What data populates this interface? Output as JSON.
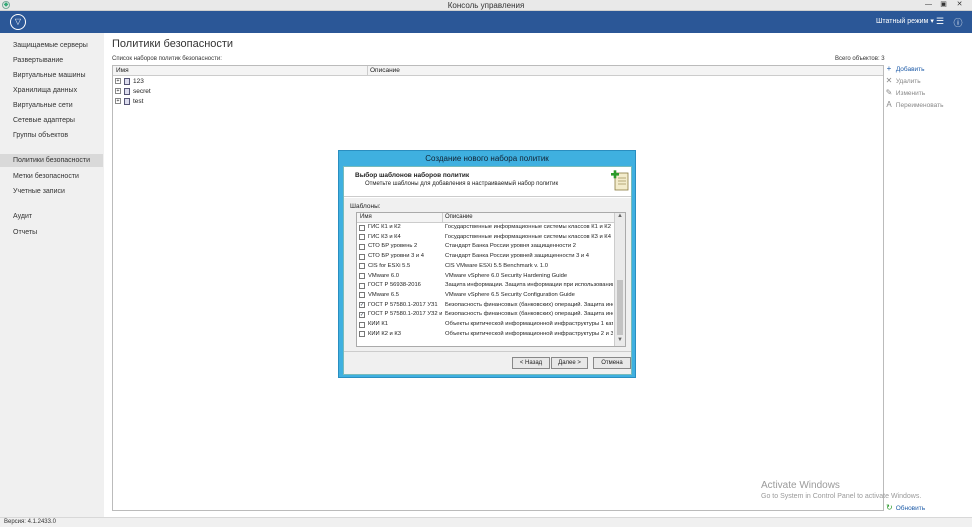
{
  "window": {
    "title": "Консоль управления",
    "min": "—",
    "max": "▣",
    "close": "✕"
  },
  "topbar": {
    "mode_label": "Штатный режим",
    "mode_arrow": "▾"
  },
  "sidebar": {
    "items": [
      {
        "label": "Защищаемые серверы"
      },
      {
        "label": "Развертывание"
      },
      {
        "label": "Виртуальные машины"
      },
      {
        "label": "Хранилища данных"
      },
      {
        "label": "Виртуальные сети"
      },
      {
        "label": "Сетевые адаптеры"
      },
      {
        "label": "Группы объектов"
      },
      {
        "label": "Политики безопасности"
      },
      {
        "label": "Метки безопасности"
      },
      {
        "label": "Учетные записи"
      },
      {
        "label": "Аудит"
      },
      {
        "label": "Отчеты"
      }
    ]
  },
  "main": {
    "title": "Политики безопасности",
    "list_label": "Список наборов политик безопасности:",
    "total": "Всего объектов: 3",
    "columns": {
      "name": "Имя",
      "description": "Описание"
    },
    "rows": [
      {
        "name": "123"
      },
      {
        "name": "secret"
      },
      {
        "name": "test"
      }
    ]
  },
  "actions": {
    "add": "Добавить",
    "delete": "Удалить",
    "edit": "Изменить",
    "rename": "Переименовать",
    "refresh": "Обновить"
  },
  "watermark": {
    "line1": "Activate Windows",
    "line2": "Go to System in Control Panel to activate Windows."
  },
  "status": {
    "version": "Версия: 4.1.2433.0"
  },
  "dialog": {
    "title": "Создание нового набора политик",
    "header_title": "Выбор шаблонов наборов политик",
    "header_sub": "Отметьте шаблоны для добавления в настраиваемый набор политик",
    "templates_label": "Шаблоны:",
    "columns": {
      "name": "Имя",
      "description": "Описание"
    },
    "templates": [
      {
        "checked": false,
        "name": "ГИС К1 и К2",
        "description": "Государственные информационные системы классов К1 и К2"
      },
      {
        "checked": false,
        "name": "ГИС К3 и К4",
        "description": "Государственные информационные системы классов К3 и К4"
      },
      {
        "checked": false,
        "name": "СТО БР уровень 2",
        "description": "Стандарт Банка России уровня защищенности 2"
      },
      {
        "checked": false,
        "name": "СТО БР уровни 3 и 4",
        "description": "Стандарт Банка России уровней защищенности 3 и 4"
      },
      {
        "checked": false,
        "name": "CIS for ESXi 5.5",
        "description": "CIS VMware ESXi 5.5 Benchmark v. 1.0"
      },
      {
        "checked": false,
        "name": "VMware 6.0",
        "description": "VMware vSphere 6.0 Security Hardening Guide"
      },
      {
        "checked": false,
        "name": "ГОСТ Р 56938-2016",
        "description": "Защита информации. Защита информации при использовании т..."
      },
      {
        "checked": false,
        "name": "VMware 6.5",
        "description": "VMware vSphere 6.5 Security Configuration Guide"
      },
      {
        "checked": true,
        "name": "ГОСТ Р 57580.1-2017 УЗ1",
        "description": "Безопасность финансовых (банковских) операций. Защита инф..."
      },
      {
        "checked": true,
        "name": "ГОСТ Р 57580.1-2017 УЗ2 и...",
        "description": "Безопасность финансовых (банковских) операций. Защита инф..."
      },
      {
        "checked": false,
        "name": "КИИ К1",
        "description": "Объекты критической информационной инфраструктуры 1 кате..."
      },
      {
        "checked": false,
        "name": "КИИ К2 и К3",
        "description": "Объекты критической информационной инфраструктуры 2 и 3 к..."
      }
    ],
    "buttons": {
      "back": "< Назад",
      "next": "Далее >",
      "cancel": "Отмена"
    }
  }
}
